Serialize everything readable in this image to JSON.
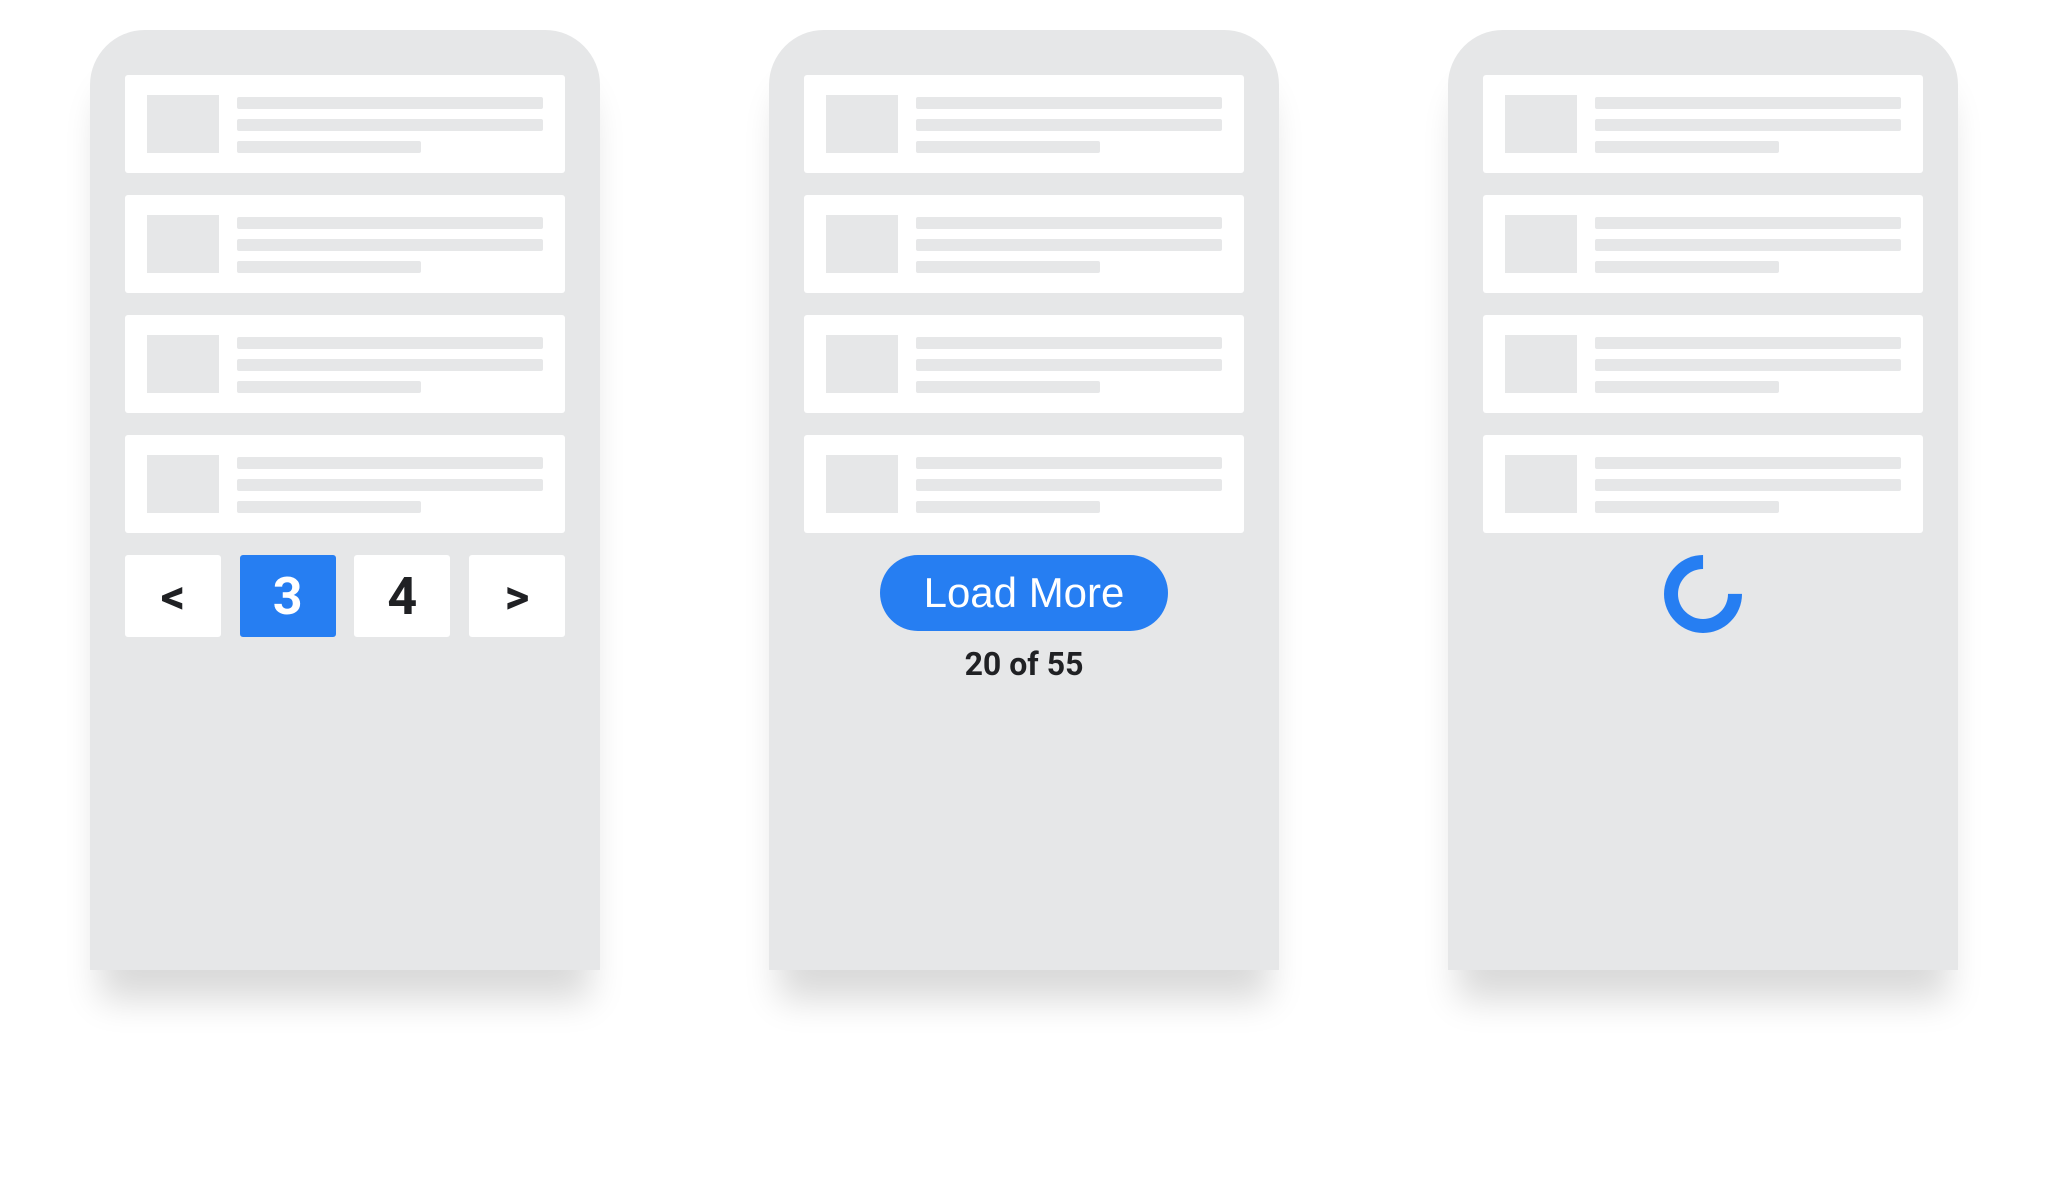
{
  "colors": {
    "accent": "#267ef2",
    "surface": "#e6e7e8",
    "card": "#ffffff",
    "text": "#202124"
  },
  "pagination": {
    "prev_label": "<",
    "next_label": ">",
    "pages": [
      "3",
      "4"
    ],
    "active_page": "3"
  },
  "load_more": {
    "button_label": "Load More",
    "count_text": "20 of 55",
    "loaded": 20,
    "total": 55
  },
  "infinite_scroll": {
    "loading": true
  }
}
